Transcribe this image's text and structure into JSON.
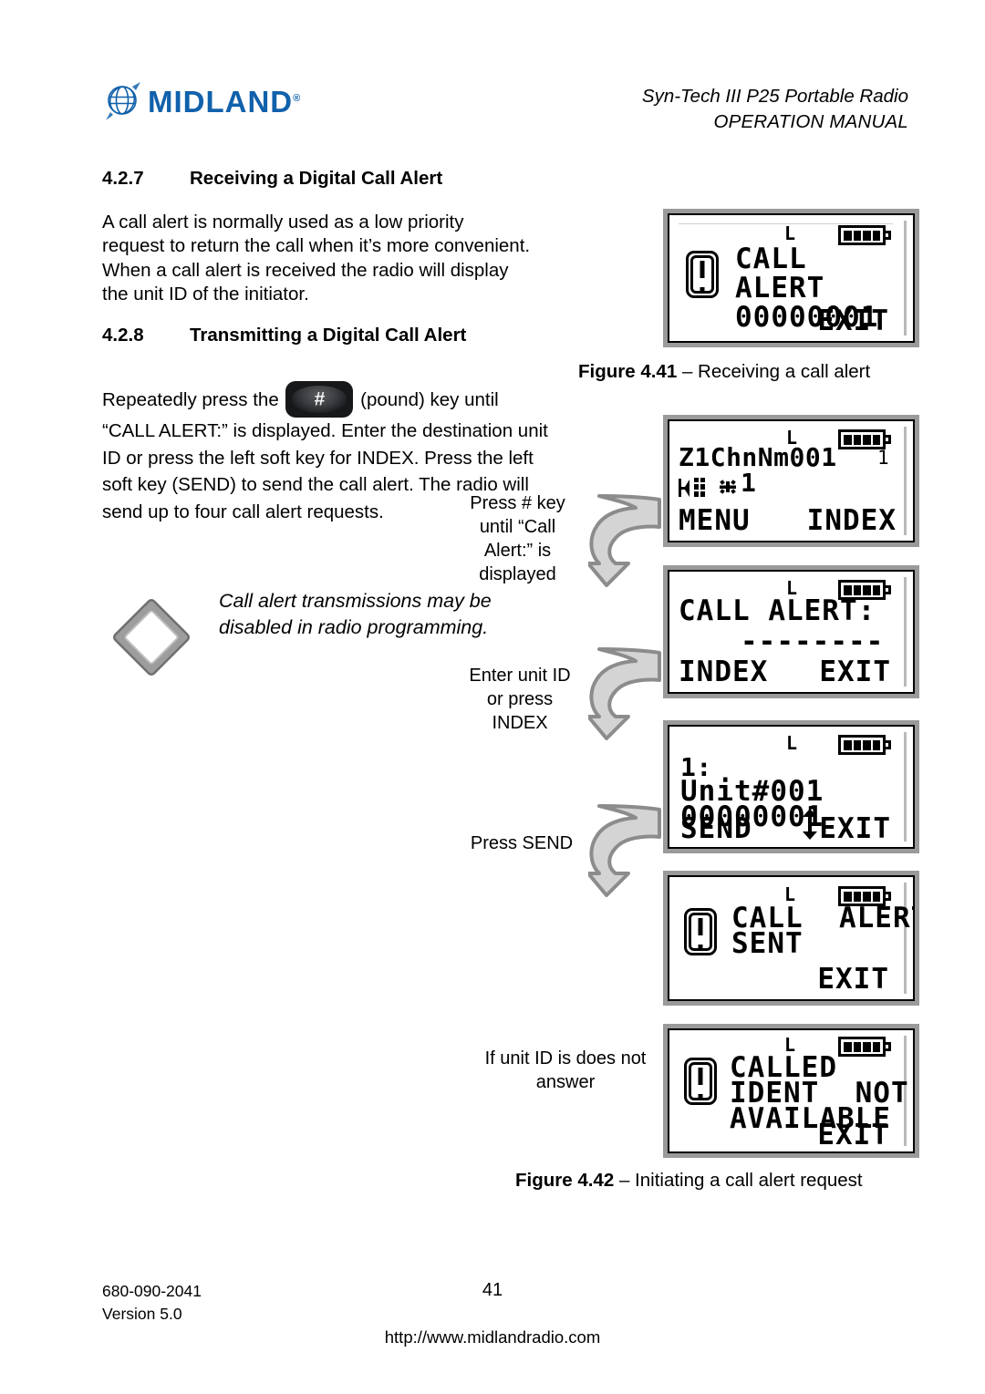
{
  "header": {
    "brand": "MIDLAND",
    "brand_reg": "®",
    "doc_line1": "Syn-Tech III P25 Portable Radio",
    "doc_line2": "OPERATION MANUAL",
    "logo_icon": "globe-icon"
  },
  "sections": {
    "s427": {
      "number": "4.2.7",
      "title": "Receiving a Digital Call Alert"
    },
    "s428": {
      "number": "4.2.8",
      "title": "Transmitting a Digital Call Alert"
    }
  },
  "body": {
    "para1": "A call alert is normally used as a low priority request to return the call when it’s more convenient. When a call alert is received the radio will display the unit ID of the initiator.",
    "transmit_pre": "Repeatedly press the ",
    "pound_key_glyph": "#",
    "transmit_post": " (pound) key until “CALL ALERT:” is displayed. Enter the destination unit ID or press the left soft key for INDEX. Press the left soft key (SEND) to send the call alert. The radio will send up to four call alert requests."
  },
  "note": {
    "badge": "NOTE",
    "text": "Call alert transmissions may be disabled in radio programming."
  },
  "figures": {
    "fig441": {
      "label": "Figure 4.41",
      "dash": " – ",
      "caption": "Receiving a call alert"
    },
    "fig442": {
      "label": "Figure 4.42",
      "dash": " – ",
      "caption": "Initiating a call alert request"
    }
  },
  "flow_labels": {
    "step1": "Press # key until “Call Alert:” is displayed",
    "step2": "Enter unit ID or press INDEX",
    "step3": "Press SEND",
    "step4": "If unit ID is does not answer"
  },
  "screens": {
    "receiving": {
      "name": "receiving-call-alert-screen",
      "signal": "L",
      "battery_bars": 4,
      "alert_icon": "alert-exclamation-icon",
      "line1": "CALL",
      "line2": "ALERT",
      "line3": "00000001",
      "softkey_right": "EXIT"
    },
    "home": {
      "name": "home-channel-screen",
      "signal": "L",
      "battery_bars": 4,
      "channel_name": "Z1ChnNm001",
      "channel_number": "1",
      "status_icon_1": "scan-list-icon",
      "status_icon_2": "star-icon",
      "status_value": "1",
      "softkey_left": "MENU",
      "softkey_right": "INDEX"
    },
    "call_alert_prompt": {
      "name": "call-alert-entry-screen",
      "signal": "L",
      "battery_bars": 4,
      "title": "CALL ALERT:",
      "entry_field": "--------",
      "softkey_left": "INDEX",
      "softkey_right": "EXIT"
    },
    "unit_select": {
      "name": "unit-id-select-screen",
      "signal": "L",
      "battery_bars": 4,
      "index_line": "1:",
      "unit_name": "Unit#001",
      "unit_id": "00000001",
      "softkey_left": "SEND",
      "scroll_icon": "up-down-arrow-icon",
      "softkey_right": "EXIT"
    },
    "sent": {
      "name": "call-alert-sent-screen",
      "signal": "L",
      "battery_bars": 4,
      "alert_icon": "alert-exclamation-icon",
      "line1": "CALL  ALERT",
      "line2": "SENT",
      "softkey_right": "EXIT"
    },
    "not_available": {
      "name": "called-ident-not-available-screen",
      "signal": "L",
      "battery_bars": 4,
      "alert_icon": "alert-exclamation-icon",
      "line1": "CALLED",
      "line2": "IDENT  NOT",
      "line3": "AVAILABLE",
      "softkey_right": "EXIT"
    }
  },
  "footer": {
    "part_number": "680-090-2041",
    "version": "Version 5.0",
    "page_number": "41",
    "url": "http://www.midlandradio.com"
  },
  "colors": {
    "brand_blue": "#1161ab",
    "lcd_bezel": "#9a9a9a",
    "arrow_outline": "#8c8c8c",
    "arrow_fill": "#d4d4d4",
    "note_gray": "#9d9d9d"
  }
}
